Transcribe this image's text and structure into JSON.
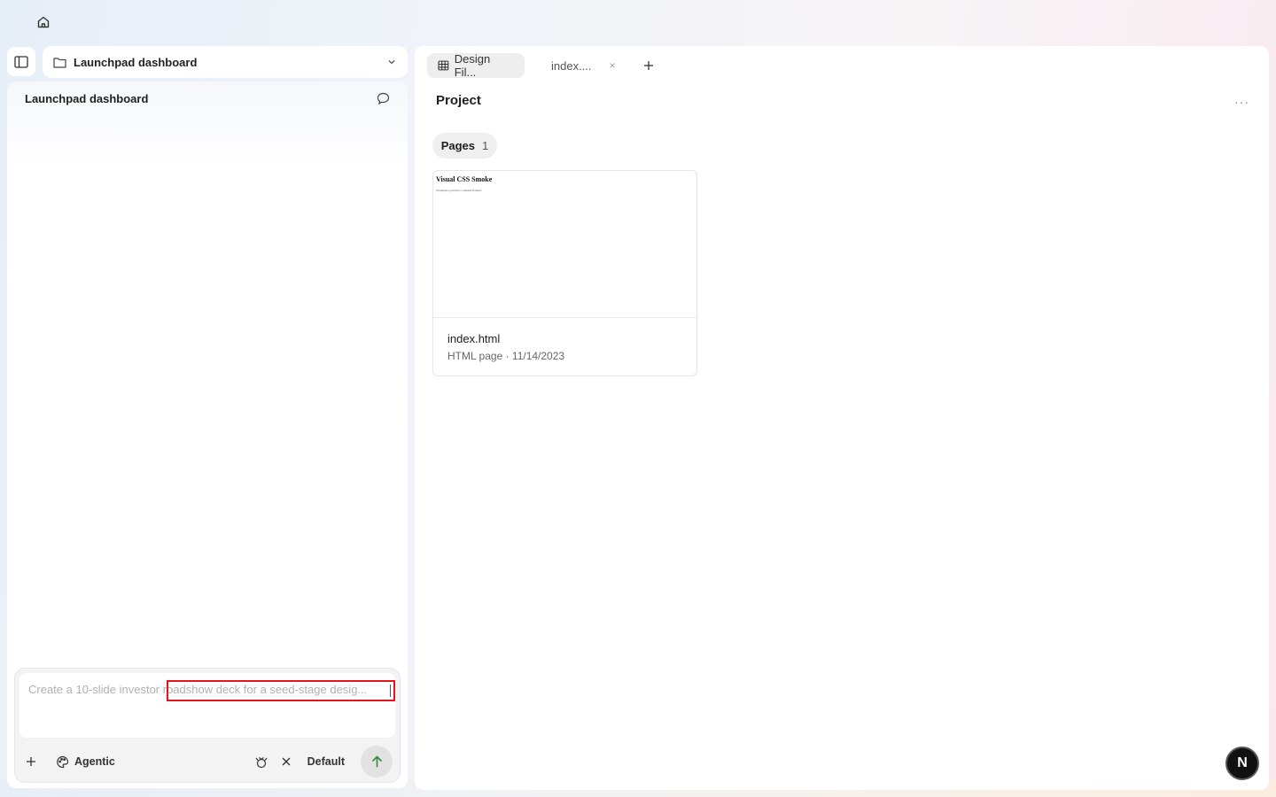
{
  "nav": {
    "home_icon": "home-icon"
  },
  "sidebar": {
    "toggle_icon": "sidebar-toggle-icon",
    "project_selector": {
      "label": "Launchpad dashboard",
      "icon": "folder-icon",
      "chevron": "chevron-down-icon"
    },
    "sessions": [
      {
        "title": "Launchpad dashboard",
        "icon": "chat-bubble-icon"
      }
    ]
  },
  "chat": {
    "placeholder": "Create a 10-slide investor roadshow deck for a seed-stage desig...",
    "value": "",
    "toolbar": {
      "add_icon": "plus-icon",
      "mode_icon": "palette-icon",
      "mode_label": "Agentic",
      "tool_icon": "tool-icon",
      "clear_icon": "close-icon",
      "model_label": "Default",
      "send_icon": "arrow-up-icon"
    }
  },
  "workspace": {
    "tabs": [
      {
        "label": "Design Fil...",
        "icon": "grid-icon",
        "active": true
      },
      {
        "label": "index....",
        "icon": "file-code-icon",
        "active": false,
        "close": "×"
      }
    ],
    "add_tab_icon": "plus-icon",
    "section_title": "Project",
    "more_label": "···",
    "filter_chip": {
      "label": "Pages",
      "count": "1"
    },
    "cards": [
      {
        "preview_title": "Visual CSS Smoke",
        "preview_subtitle": "Workspace preview contains framed.",
        "name": "index.html",
        "meta": "HTML page · 11/14/2023"
      }
    ]
  },
  "user": {
    "avatar_letter": "N"
  },
  "colors": {
    "highlight": "#e3161b",
    "send_arrow": "#2e8b3a",
    "avatar_bg": "#111111"
  }
}
